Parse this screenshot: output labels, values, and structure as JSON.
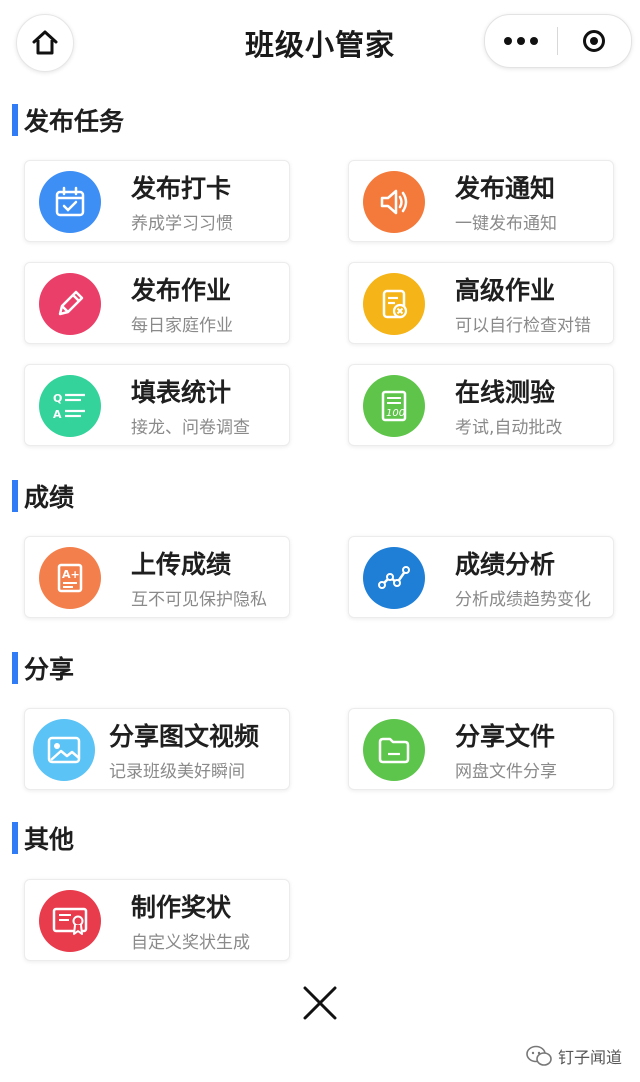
{
  "header": {
    "title": "班级小管家"
  },
  "sections": [
    {
      "title": "发布任务",
      "cards": [
        {
          "title": "发布打卡",
          "subtitle": "养成学习习惯",
          "icon": "calendar-check-icon",
          "color": "#3d8ef5"
        },
        {
          "title": "发布通知",
          "subtitle": "一键发布通知",
          "icon": "speaker-icon",
          "color": "#f47a3c"
        },
        {
          "title": "发布作业",
          "subtitle": "每日家庭作业",
          "icon": "pencil-icon",
          "color": "#ea3f68"
        },
        {
          "title": "高级作业",
          "subtitle": "可以自行检查对错",
          "icon": "homework-check-icon",
          "color": "#f5b417"
        },
        {
          "title": "填表统计",
          "subtitle": "接龙、问卷调查",
          "icon": "qa-form-icon",
          "color": "#33d39b"
        },
        {
          "title": "在线测验",
          "subtitle": "考试,自动批改",
          "icon": "exam-paper-icon",
          "color": "#5ec54a"
        }
      ]
    },
    {
      "title": "成绩",
      "cards": [
        {
          "title": "上传成绩",
          "subtitle": "互不可见保护隐私",
          "icon": "grade-upload-icon",
          "color": "#f3804c"
        },
        {
          "title": "成绩分析",
          "subtitle": "分析成绩趋势变化",
          "icon": "trend-icon",
          "color": "#1f7fd6"
        }
      ]
    },
    {
      "title": "分享",
      "cards": [
        {
          "title": "分享图文视频",
          "subtitle": "记录班级美好瞬间",
          "icon": "image-icon",
          "color": "#5bc3f5"
        },
        {
          "title": "分享文件",
          "subtitle": "网盘文件分享",
          "icon": "folder-icon",
          "color": "#5dc54b"
        }
      ]
    },
    {
      "title": "其他",
      "cards": [
        {
          "title": "制作奖状",
          "subtitle": "自定义奖状生成",
          "icon": "certificate-icon",
          "color": "#e83b4c"
        }
      ]
    }
  ],
  "footer": {
    "watermark": "钉子闻道"
  }
}
